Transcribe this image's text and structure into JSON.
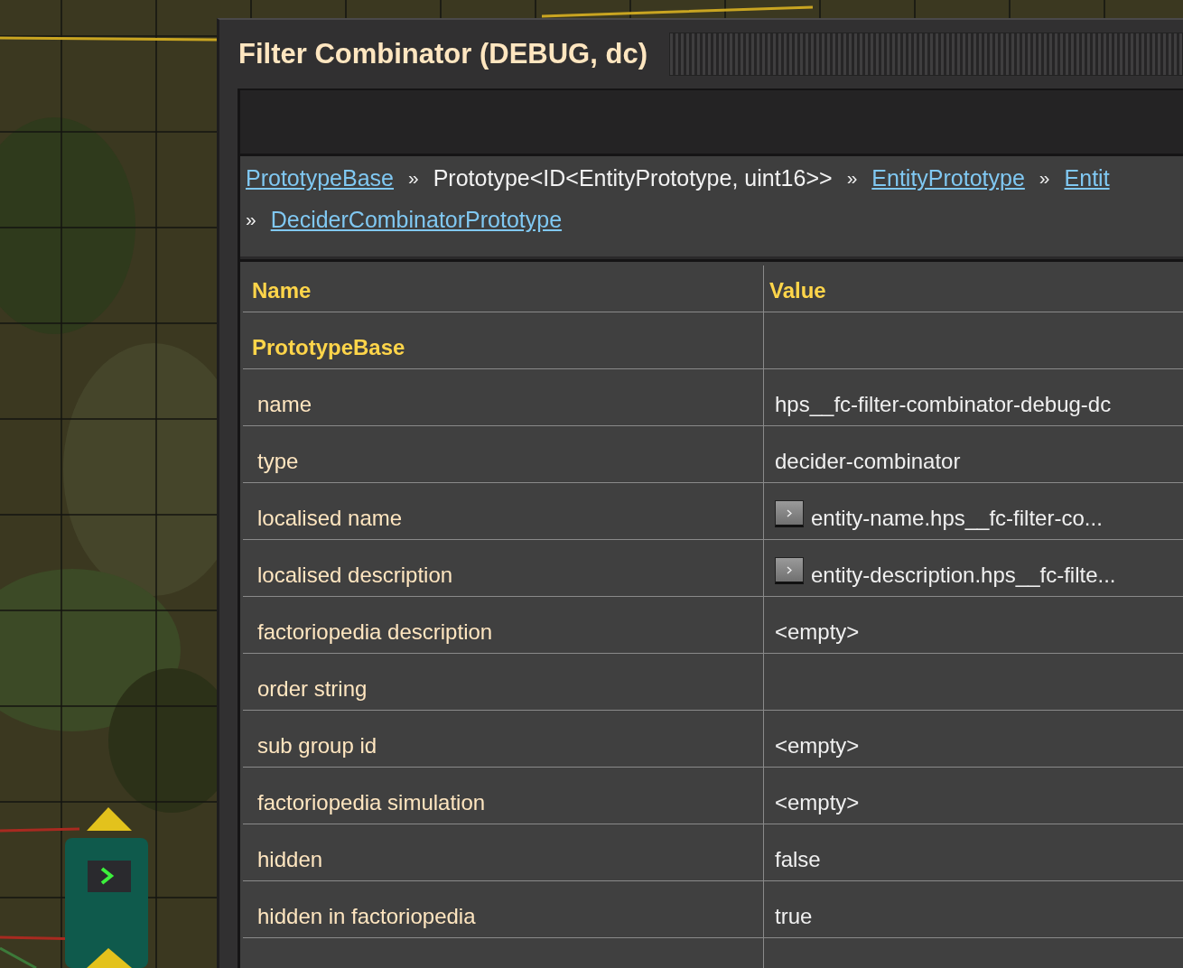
{
  "window": {
    "title": "Filter Combinator (DEBUG, dc)"
  },
  "breadcrumb": {
    "lines": [
      [
        {
          "kind": "link",
          "text": "PrototypeBase"
        },
        {
          "kind": "separator",
          "text": "»"
        },
        {
          "kind": "plain",
          "text": "Prototype<ID<EntityPrototype, uint16>>"
        },
        {
          "kind": "separator",
          "text": "»"
        },
        {
          "kind": "link",
          "text": "EntityPrototype"
        },
        {
          "kind": "separator",
          "text": "»"
        },
        {
          "kind": "link",
          "text": "Entit"
        }
      ],
      [
        {
          "kind": "separator",
          "text": "»"
        },
        {
          "kind": "link",
          "text": "DeciderCombinatorPrototype"
        }
      ]
    ]
  },
  "table": {
    "columns": [
      "Name",
      "Value"
    ],
    "rows": [
      {
        "kind": "section",
        "name": "PrototypeBase"
      },
      {
        "kind": "field",
        "name": "name",
        "value": "hps__fc-filter-combinator-debug-dc"
      },
      {
        "kind": "field",
        "name": "type",
        "value": "decider-combinator"
      },
      {
        "kind": "field",
        "name": "localised name",
        "value": "entity-name.hps__fc-filter-co...",
        "expandable": true
      },
      {
        "kind": "field",
        "name": "localised description",
        "value": "entity-description.hps__fc-filte...",
        "expandable": true
      },
      {
        "kind": "field",
        "name": "factoriopedia description",
        "value": "<empty>"
      },
      {
        "kind": "field",
        "name": "order string"
      },
      {
        "kind": "field",
        "name": "sub group id",
        "value": "<empty>"
      },
      {
        "kind": "field",
        "name": "factoriopedia simulation",
        "value": "<empty>"
      },
      {
        "kind": "field",
        "name": "hidden",
        "value": "false"
      },
      {
        "kind": "field",
        "name": "hidden in factoriopedia",
        "value": "true"
      }
    ]
  }
}
